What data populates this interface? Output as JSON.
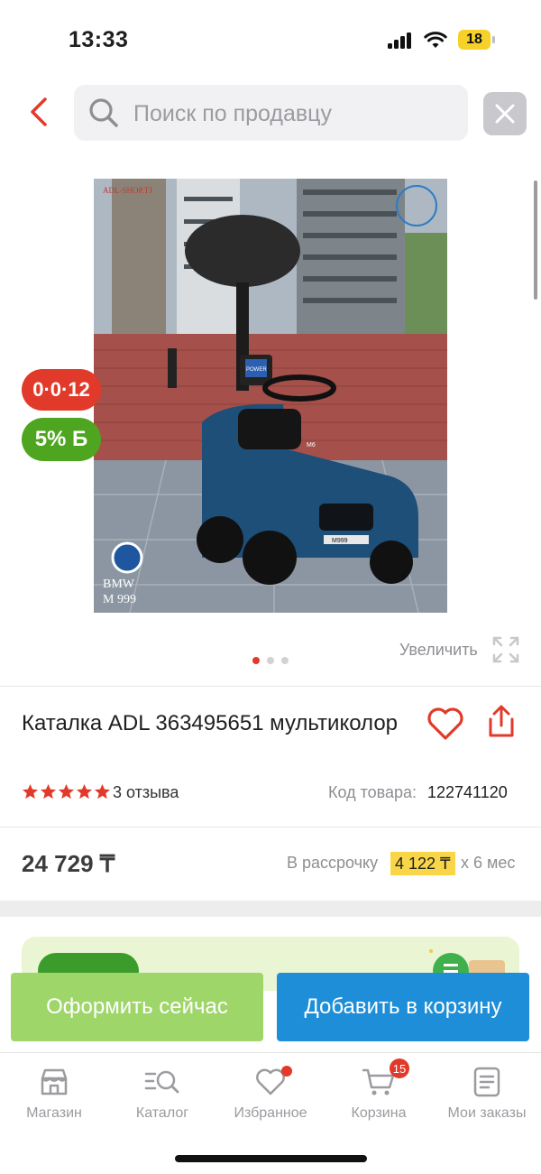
{
  "status": {
    "time": "13:33",
    "battery": "18"
  },
  "header": {
    "search_placeholder": "Поиск по продавцу"
  },
  "product": {
    "badge_installment": "0·0·12",
    "badge_bonus": "5% Б",
    "image_overlay": {
      "site": "ADL-SHOP.TJ",
      "brand": "BMW",
      "model": "M 999",
      "power": "POWER",
      "plate": "M999",
      "grille_badge": "M6"
    },
    "zoom_label": "Увеличить",
    "title": "Каталка ADL 363495651 мультиколор",
    "rating": 5,
    "reviews": "3 отзыва",
    "code_label": "Код товара:",
    "code_value": "122741120",
    "price": "24 729 ₸",
    "installment_label": "В рассрочку",
    "installment_amount": "4 122 ₸",
    "installment_months": "х 6 мес"
  },
  "actions": {
    "buy_now": "Оформить сейчас",
    "add_to_cart": "Добавить в корзину"
  },
  "tabbar": {
    "items": [
      {
        "label": "Магазин",
        "icon": "store-icon"
      },
      {
        "label": "Каталог",
        "icon": "catalog-search-icon"
      },
      {
        "label": "Избранное",
        "icon": "heart-icon"
      },
      {
        "label": "Корзина",
        "icon": "cart-icon",
        "badge": "15"
      },
      {
        "label": "Мои заказы",
        "icon": "orders-icon"
      }
    ]
  },
  "colors": {
    "accent_red": "#e23a2a",
    "green": "#4ea51f",
    "blue_button": "#1f8ed8",
    "light_green_button": "#9fd66a",
    "installment_highlight": "#f9d648"
  }
}
